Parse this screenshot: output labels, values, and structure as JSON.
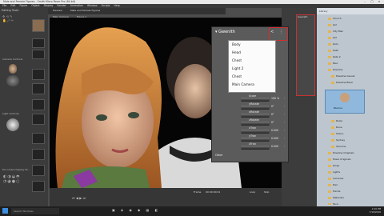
{
  "window": {
    "title": "Male and Female Figures - Smith Micro Poser Pro (64-bit)"
  },
  "menus": [
    "File",
    "Edit",
    "Figure",
    "Object",
    "Display",
    "Render",
    "Animation",
    "Window",
    "Scripts",
    "Help"
  ],
  "left_panel": {
    "title": "Editing Tools",
    "camera_controls": "Camera Controls",
    "light_controls": "Light Controls",
    "document_display": "Document Display St..."
  },
  "viewport": {
    "tabs": [
      "Preview",
      "Male and Female Figures"
    ],
    "camera": "Main Camera",
    "figure": "Figure 1"
  },
  "popup": {
    "title": "Gwenith",
    "menu_items": [
      "Body",
      "Head",
      "Chest",
      "Light 2",
      "Chest",
      "Main Camera"
    ],
    "dials": [
      {
        "label": "Scale",
        "value": "100 %"
      },
      {
        "label": "yRotate",
        "value": "0°"
      },
      {
        "label": "xRotate",
        "value": "0°"
      },
      {
        "label": "zRotate",
        "value": "0°"
      },
      {
        "label": "xTran",
        "value": "0.000"
      },
      {
        "label": "yTran",
        "value": "0.000"
      },
      {
        "label": "zTran",
        "value": "0.000"
      }
    ],
    "footer": "Other"
  },
  "library": {
    "title": "Library",
    "items": [
      "Church",
      "Girl",
      "City Man",
      "Girl",
      "Girls",
      "Kate",
      "Kate 2",
      "Paul",
      "Poseline",
      "Poseline Casual",
      "Poseline Basic",
      "Roxie",
      "Rune",
      "Shaun",
      "Sydney",
      "Yasmine",
      "Poseline Originals",
      "Poser Originals",
      "Props",
      "Lights",
      "Cameras",
      "Hair",
      "Hands",
      "Materials",
      "Face",
      "Pose",
      "Scenes"
    ],
    "selected_thumb": "Paulina"
  },
  "timeline": {
    "frame_label": "Frame",
    "frame_value": "00:00:00:01",
    "loop": "Loop",
    "end": "Skip"
  },
  "taskbar": {
    "search": "Search Windows",
    "time": "2:10 PM",
    "date": "7/19/2016"
  },
  "colors": {
    "accent": "#c83232",
    "menu_bg": "#fbfbfb",
    "library_bg": "#bdc6cf"
  }
}
